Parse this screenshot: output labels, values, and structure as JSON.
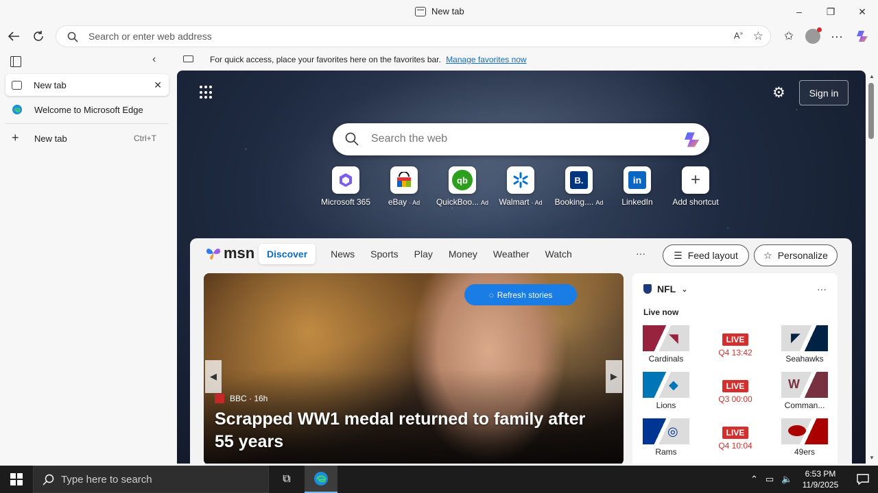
{
  "window": {
    "title": "New tab",
    "minimize": "–",
    "maximize": "❐",
    "close": "✕"
  },
  "address_bar": {
    "placeholder": "Search or enter web address"
  },
  "sidebar": {
    "tabs": [
      {
        "label": "New tab",
        "close": "✕"
      },
      {
        "label": "Welcome to Microsoft Edge"
      }
    ],
    "new_tab": {
      "label": "New tab",
      "shortcut": "Ctrl+T"
    }
  },
  "favorites_bar": {
    "text": "For quick access, place your favorites here on the favorites bar.",
    "link": "Manage favorites now"
  },
  "newtab": {
    "sign_in": "Sign in",
    "search_placeholder": "Search the web",
    "shortcuts": [
      {
        "label": "Microsoft 365",
        "ad": ""
      },
      {
        "label": "eBay",
        "ad": "· Ad"
      },
      {
        "label": "QuickBoo...",
        "ad": "Ad"
      },
      {
        "label": "Walmart",
        "ad": "· Ad"
      },
      {
        "label": "Booking....",
        "ad": "Ad"
      },
      {
        "label": "LinkedIn",
        "ad": ""
      },
      {
        "label": "Add shortcut",
        "ad": ""
      }
    ]
  },
  "msn": {
    "logo": "msn",
    "nav": [
      "Discover",
      "News",
      "Sports",
      "Play",
      "Money",
      "Weather",
      "Watch"
    ],
    "more": "···",
    "feed_layout": "Feed layout",
    "personalize": "Personalize",
    "refresh": "Refresh stories",
    "story": {
      "source": "BBC · 16h",
      "headline": "Scrapped WW1 medal returned to family after 55 years"
    },
    "nfl": {
      "title": "NFL",
      "more": "···",
      "live_now": "Live now",
      "games": [
        {
          "home": "Cardinals",
          "away": "Seahawks",
          "status": "LIVE",
          "time": "Q4 13:42",
          "home_color": "#97233f",
          "away_color": "#002244"
        },
        {
          "home": "Lions",
          "away": "Comman...",
          "status": "LIVE",
          "time": "Q3 00:00",
          "home_color": "#0076b6",
          "away_color": "#773141"
        },
        {
          "home": "Rams",
          "away": "49ers",
          "status": "LIVE",
          "time": "Q4 10:04",
          "home_color": "#003594",
          "away_color": "#aa0000"
        }
      ]
    }
  },
  "taskbar": {
    "search_placeholder": "Type here to search",
    "time": "6:53 PM",
    "date": "11/9/2025"
  }
}
